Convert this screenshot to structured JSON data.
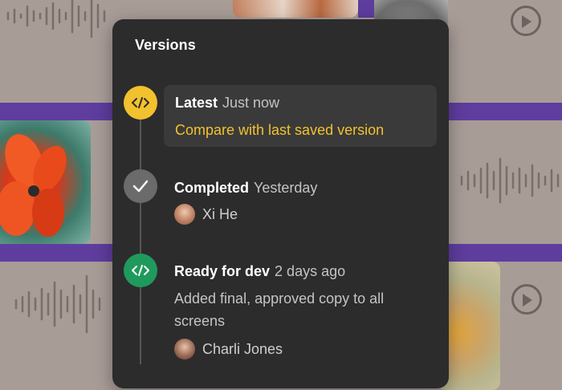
{
  "panel": {
    "title": "Versions",
    "versions": [
      {
        "name": "Latest",
        "time": "Just now",
        "link": "Compare with last saved version",
        "icon": "code-icon",
        "color": "#f2c12e"
      },
      {
        "name": "Completed",
        "time": "Yesterday",
        "author": "Xi He",
        "icon": "check-icon",
        "color": "#6b6b6b"
      },
      {
        "name": "Ready for dev",
        "time": "2 days ago",
        "description": "Added final, approved copy to all screens",
        "author": "Charli Jones",
        "icon": "code-icon",
        "color": "#1f9a5c"
      }
    ]
  },
  "background": {
    "tile_color": "#a89c97",
    "stripe_color": "#5e3d9e",
    "icons": [
      "audio-waveform-icon",
      "play-icon",
      "photo-texture-icon",
      "photo-flower-icon"
    ]
  }
}
